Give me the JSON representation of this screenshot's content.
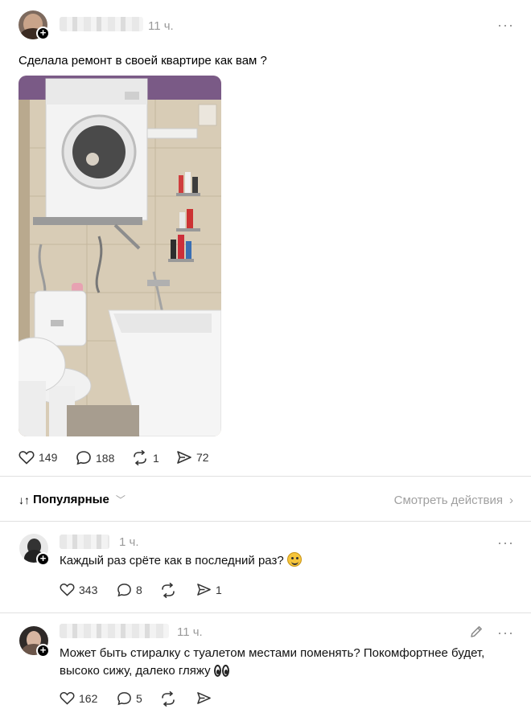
{
  "post": {
    "time": "11 ч.",
    "more": "···",
    "text": "Сделала ремонт в своей квартире как вам ?",
    "stats": {
      "likes": "149",
      "comments": "188",
      "reposts": "1",
      "shares": "72"
    }
  },
  "sort_bar": {
    "label": "Популярные",
    "actions_link": "Смотреть действия"
  },
  "comments": [
    {
      "time": "1 ч.",
      "text": "Каждый раз срёте как в последний раз?",
      "stats": {
        "likes": "343",
        "comments": "8"
      },
      "share_count": "1"
    },
    {
      "time": "11 ч.",
      "text_line1": "Может быть стиралку с туалетом местами поменять? Покомфортнее будет,",
      "text_line2": "высоко сижу, далеко гляжу",
      "stats": {
        "likes": "162",
        "comments": "5"
      }
    }
  ],
  "colors": {
    "accent_dark": "#000000",
    "muted": "#9a9a9a",
    "divider": "#e0e0e0"
  },
  "icons": [
    "heart-icon",
    "comment-icon",
    "repost-icon",
    "share-icon",
    "more-icon",
    "edit-icon",
    "chevron-down-icon",
    "chevron-right-icon",
    "sort-icon",
    "plus-icon"
  ]
}
